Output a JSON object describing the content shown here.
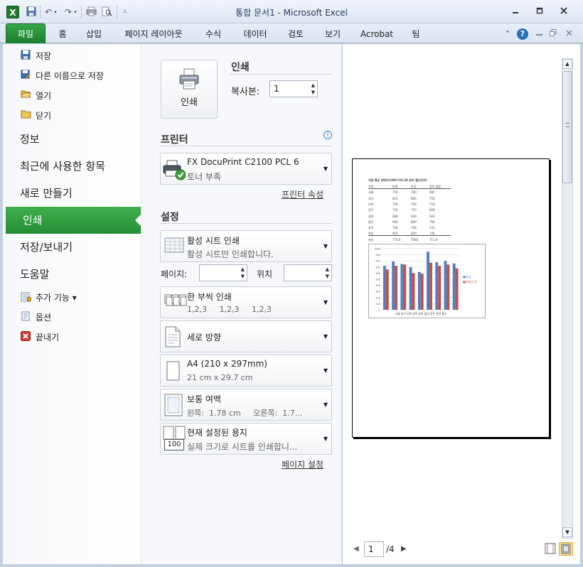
{
  "window": {
    "title": "통합 문서1  -  Microsoft Excel",
    "app_icon": "X"
  },
  "ribbon": {
    "tabs": [
      "파일",
      "홈",
      "삽입",
      "페이지 레이아웃",
      "수식",
      "데이터",
      "검토",
      "보기",
      "Acrobat",
      "팀"
    ],
    "help": "?"
  },
  "backstage": {
    "commands_top": [
      {
        "label": "저장",
        "icon": "save-icon"
      },
      {
        "label": "다른 이름으로 저장",
        "icon": "save-as-icon"
      },
      {
        "label": "열기",
        "icon": "open-folder-icon"
      },
      {
        "label": "닫기",
        "icon": "close-folder-icon"
      }
    ],
    "categories": [
      "정보",
      "최근에 사용한 항목",
      "새로 만들기",
      "인쇄",
      "저장/보내기",
      "도움말"
    ],
    "commands_bottom": [
      {
        "label": "추가 기능 ▾",
        "icon": "addin-icon"
      },
      {
        "label": "옵션",
        "icon": "options-icon"
      },
      {
        "label": "끝내기",
        "icon": "exit-icon"
      }
    ]
  },
  "print": {
    "section_title": "인쇄",
    "print_button_label": "인쇄",
    "copies_label": "복사본:",
    "copies_value": "1",
    "printer_header": "프린터",
    "printer_name": "FX DocuPrint C2100 PCL 6",
    "printer_status": "토너 부족",
    "printer_properties": "프린터 속성",
    "settings_header": "설정",
    "what_title": "활성 시트 인쇄",
    "what_sub": "활성 시트만 인쇄합니다.",
    "pages_label": "페이지:",
    "to_label": "위치",
    "collate_title": "한 부씩 인쇄",
    "collate_sub": "1,2,3     1,2,3     1,2,3",
    "orientation": "세로 방향",
    "paper_title": "A4 (210 x 297mm)",
    "paper_sub": "21 cm x 29.7 cm",
    "margins_title": "보통 여백",
    "margins_sub": "왼쪽:  1.78 cm     오른쪽:  1.7...",
    "scaling_title": "현재 설정된 용지",
    "scaling_sub": "실제 크기로 시트를 인쇄합니...",
    "scaling_icon_text": "100",
    "page_setup": "페이지 설정"
  },
  "preview": {
    "current_page": "1",
    "total_pages": "/4",
    "mini_sheet": {
      "title": "지점 평균 판매가(1997-03-20 원지 월)(단위)",
      "header": [
        "지역",
        "판매",
        "판당",
        "정보 총합"
      ],
      "rows": [
        [
          "서울",
          "750",
          "700",
          "687"
        ],
        [
          "대구",
          "810",
          "800",
          "752"
        ],
        [
          "인천",
          "750",
          "750",
          "758"
        ],
        [
          "광주",
          "750",
          "710",
          "828"
        ],
        [
          "대전",
          "680",
          "630",
          "603"
        ],
        [
          "울산",
          "960",
          "800",
          "766"
        ],
        [
          "광주",
          "700",
          "730",
          "721"
        ],
        [
          "천안",
          "810",
          "820",
          "746"
        ]
      ],
      "total": [
        "총합",
        "775.6",
        "7065",
        "711.6"
      ],
      "chart_yticks": [
        "1000",
        "900",
        "800",
        "700",
        "600",
        "500",
        "400",
        "300",
        "200",
        "100",
        "0"
      ],
      "chart_cats": "서울 대구 인천 광주 대전 울산 광주 천안 평균",
      "legend": [
        "■금값",
        "■판매금 등"
      ],
      "series_a": [
        720,
        790,
        750,
        700,
        620,
        950,
        780,
        800,
        760
      ],
      "series_b": [
        660,
        720,
        740,
        600,
        590,
        770,
        720,
        740,
        680
      ],
      "colors": {
        "a": "#4f81bd",
        "b": "#c0504d"
      }
    }
  }
}
